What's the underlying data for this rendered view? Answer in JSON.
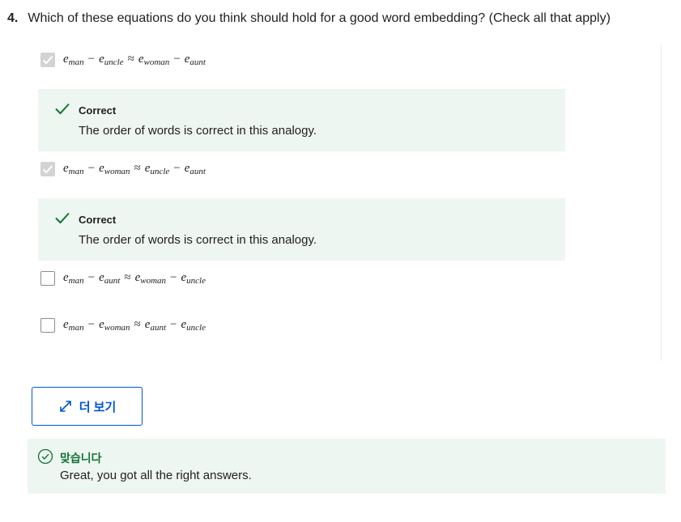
{
  "question": {
    "number": "4.",
    "text": "Which of these equations do you think should hold for a good word embedding? (Check all that apply)"
  },
  "options": [
    {
      "checked": true,
      "a": "man",
      "b": "uncle",
      "c": "woman",
      "d": "aunt"
    },
    {
      "checked": true,
      "a": "man",
      "b": "woman",
      "c": "uncle",
      "d": "aunt"
    },
    {
      "checked": false,
      "a": "man",
      "b": "aunt",
      "c": "woman",
      "d": "uncle"
    },
    {
      "checked": false,
      "a": "man",
      "b": "woman",
      "c": "aunt",
      "d": "uncle"
    }
  ],
  "symbols": {
    "e": "e",
    "minus": "−",
    "approx": "≈"
  },
  "feedback": [
    {
      "title": "Correct",
      "text": "The order of words is correct in this analogy."
    },
    {
      "title": "Correct",
      "text": "The order of words is correct in this analogy."
    }
  ],
  "more_button": {
    "label": "더 보기",
    "icon": "expand-arrows-icon"
  },
  "result": {
    "title": "맞습니다",
    "text": "Great, you got all the right answers.",
    "icon": "check-circle-icon"
  },
  "colors": {
    "accent_blue": "#0056d2",
    "success_green": "#137333",
    "feedback_bg": "#eef6f1",
    "checked_box": "#d3d3d3"
  }
}
